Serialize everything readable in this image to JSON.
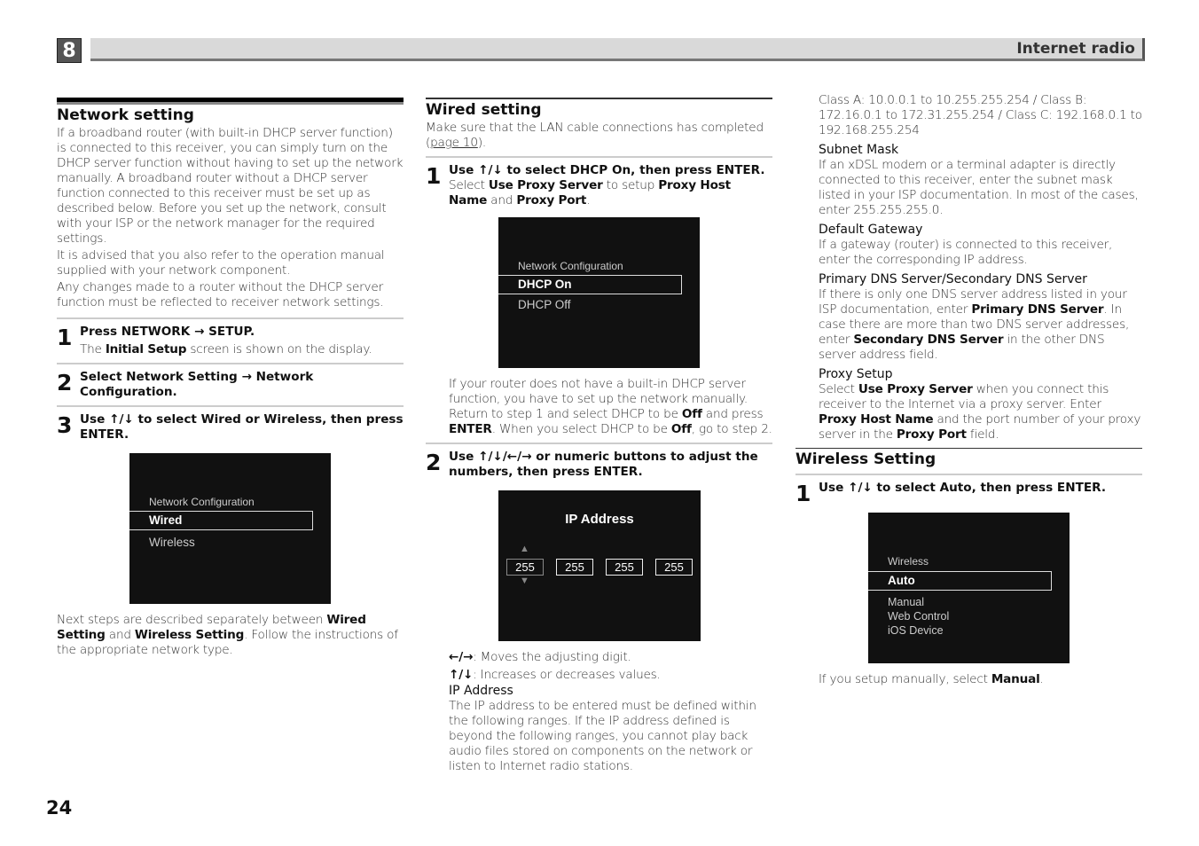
{
  "header": {
    "chapter": "8",
    "title": "Internet radio"
  },
  "page_number": "24",
  "left": {
    "title": "Network setting",
    "intro": [
      [
        {
          "t": "If a broadband router (with built-in DHCP server function) is connected to this receiver, you can simply turn on the DHCP server function without having to set up the network manually. A broadband router without a DHCP server function connected to this receiver must be set up as described below. Before you set up the network, consult with your ISP or the network manager for the required settings."
        }
      ],
      [
        {
          "t": "It is advised that you also refer to the operation manual supplied with your network component."
        }
      ],
      [
        {
          "t": "Any changes made to a router without the DHCP server function must be reflected to receiver network settings."
        }
      ]
    ],
    "steps": [
      {
        "num": "1",
        "head": "Press NETWORK → SETUP.",
        "body": [
          {
            "t": "The "
          },
          {
            "t": "Initial Setup",
            "b": true
          },
          {
            "t": " screen is shown on the display."
          }
        ]
      },
      {
        "num": "2",
        "head": "Select Network Setting → Network Configuration.",
        "body": []
      },
      {
        "num": "3",
        "head": "Use ↑/↓ to select Wired or Wireless, then press ENTER.",
        "body": []
      }
    ],
    "osd": {
      "caption": "Network Configuration",
      "selected": "Wired",
      "items": [
        "Wireless"
      ]
    },
    "outro": [
      {
        "t": "Next steps are described separately between "
      },
      {
        "t": "Wired Setting",
        "b": true
      },
      {
        "t": " and "
      },
      {
        "t": "Wireless Setting",
        "b": true
      },
      {
        "t": ". Follow the instructions of the appropriate network type."
      }
    ]
  },
  "middle": {
    "title": "Wired setting",
    "intro": [
      {
        "t": "Make sure that the LAN cable connections has completed ("
      },
      {
        "t": "page 10",
        "u": true
      },
      {
        "t": ")."
      }
    ],
    "step1": {
      "num": "1",
      "head": "Use ↑/↓ to select DHCP On, then press ENTER.",
      "body": [
        {
          "t": "Select "
        },
        {
          "t": "Use Proxy Server",
          "b": true
        },
        {
          "t": " to setup "
        },
        {
          "t": "Proxy Host Name",
          "b": true
        },
        {
          "t": " and "
        },
        {
          "t": "Proxy Port",
          "b": true
        },
        {
          "t": "."
        }
      ]
    },
    "osd1": {
      "caption": "Network Configuration",
      "selected": "DHCP On",
      "items": [
        "DHCP Off"
      ]
    },
    "note": [
      {
        "t": "If your router does not have a built-in DHCP server function, you have to set up the network manually. Return to step 1 and select DHCP to be "
      },
      {
        "t": "Off",
        "b": true
      },
      {
        "t": " and press "
      },
      {
        "t": "ENTER",
        "b": true
      },
      {
        "t": ". When you select DHCP to be "
      },
      {
        "t": "Off",
        "b": true
      },
      {
        "t": ", go to step 2."
      }
    ],
    "step2": {
      "num": "2",
      "head": "Use ↑/↓/←/→ or numeric buttons to adjust the numbers, then press ENTER."
    },
    "osd2": {
      "title": "IP Address",
      "octets": [
        "255",
        "255",
        "255",
        "255"
      ]
    },
    "legend": [
      [
        {
          "t": "←/→",
          "b": true
        },
        {
          "t": ": Moves the adjusting digit."
        }
      ],
      [
        {
          "t": "↑/↓",
          "b": true
        },
        {
          "t": ": Increases or decreases values."
        }
      ]
    ],
    "ip_title": "IP Address",
    "ip_text": [
      {
        "t": "The IP address to be entered must be defined within the following ranges. If the IP address defined is beyond the following ranges, you cannot play back audio files stored on components on the network or listen to Internet radio stations."
      }
    ]
  },
  "right": {
    "ranges": [
      {
        "t": "Class A: 10.0.0.1 to 10.255.255.254 / Class B: 172.16.0.1 to 172.31.255.254 / Class C: 192.168.0.1 to 192.168.255.254"
      }
    ],
    "sections": [
      {
        "title": "Subnet Mask",
        "text": [
          {
            "t": "If an xDSL modem or a terminal adapter is directly connected to this receiver, enter the subnet mask listed in your ISP documentation. In most of the cases, enter 255.255.255.0."
          }
        ]
      },
      {
        "title": "Default Gateway",
        "text": [
          {
            "t": "If a gateway (router) is connected to this receiver, enter the corresponding IP address."
          }
        ]
      },
      {
        "title": "Primary DNS Server/Secondary DNS Server",
        "text": [
          {
            "t": "If there is only one DNS server address listed in your ISP documentation, enter "
          },
          {
            "t": "Primary DNS Server",
            "b": true
          },
          {
            "t": ". In case there are more than two DNS server addresses, enter "
          },
          {
            "t": "Secondary DNS Server",
            "b": true
          },
          {
            "t": " in the other DNS server address field."
          }
        ]
      },
      {
        "title": "Proxy Setup",
        "text": [
          {
            "t": "Select "
          },
          {
            "t": "Use Proxy Server",
            "b": true
          },
          {
            "t": " when you connect this receiver to the Internet via a proxy server. Enter "
          },
          {
            "t": "Proxy Host Name",
            "b": true
          },
          {
            "t": " and the port number of your proxy server in the "
          },
          {
            "t": "Proxy Port",
            "b": true
          },
          {
            "t": " field."
          }
        ]
      }
    ],
    "wireless_title": "Wireless Setting",
    "step1": {
      "num": "1",
      "head": "Use ↑/↓ to select Auto, then press ENTER."
    },
    "osd": {
      "caption": "Wireless",
      "selected": "Auto",
      "items": [
        "Manual",
        "Web Control",
        "iOS Device"
      ]
    },
    "note": [
      {
        "t": "If you setup manually, select "
      },
      {
        "t": "Manual",
        "b": true
      },
      {
        "t": "."
      }
    ]
  }
}
